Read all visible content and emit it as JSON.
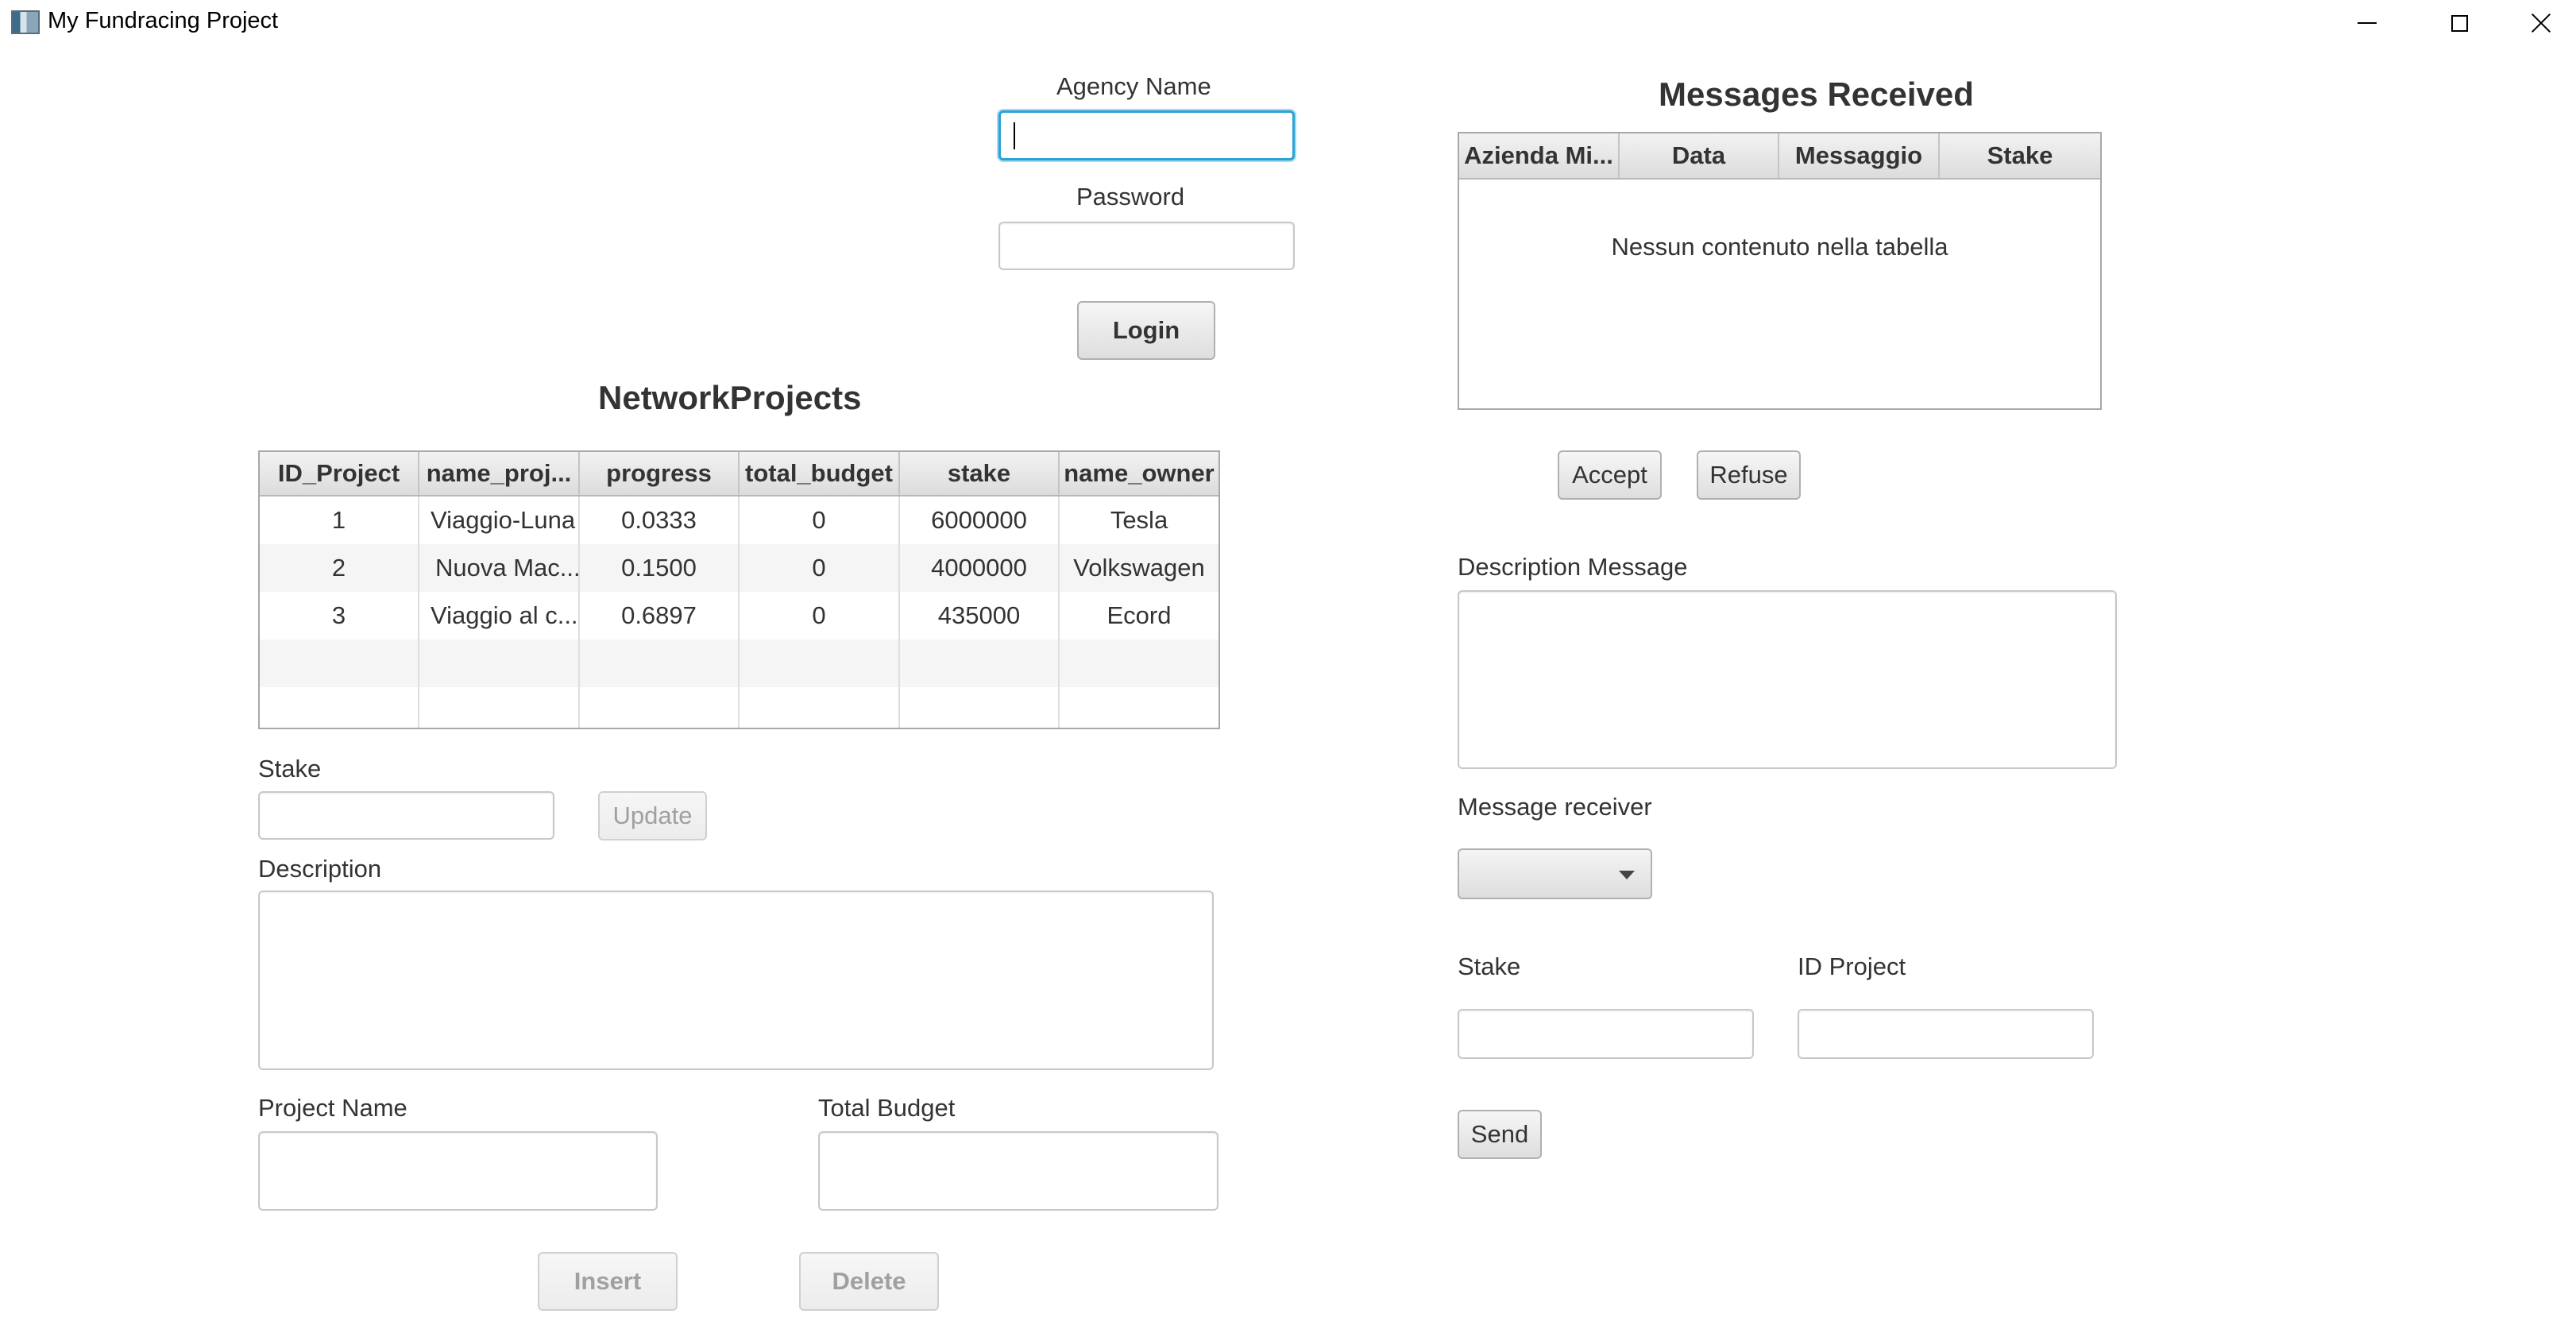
{
  "window": {
    "title": "My Fundracing Project",
    "controls": {
      "minimize": "minimize-icon",
      "maximize": "maximize-icon",
      "close": "close-icon"
    }
  },
  "login": {
    "agency_label": "Agency Name",
    "agency_value": "",
    "password_label": "Password",
    "password_value": "",
    "login_button": "Login"
  },
  "network_projects": {
    "title": "NetworkProjects",
    "columns": [
      "ID_Project",
      "name_proj...",
      "progress",
      "total_budget",
      "stake",
      "name_owner"
    ],
    "rows": [
      [
        "1",
        "Viaggio-Luna",
        "0.0333",
        "0",
        "6000000",
        "Tesla"
      ],
      [
        "2",
        "Nuova Mac...",
        "0.1500",
        "0",
        "4000000",
        "Volkswagen"
      ],
      [
        "3",
        "Viaggio al c...",
        "0.6897",
        "0",
        "435000",
        "Ecord"
      ]
    ]
  },
  "project_form": {
    "stake_label": "Stake",
    "stake_value": "",
    "update_button": "Update",
    "description_label": "Description",
    "description_value": "",
    "project_name_label": "Project Name",
    "project_name_value": "",
    "total_budget_label": "Total Budget",
    "total_budget_value": "",
    "insert_button": "Insert",
    "delete_button": "Delete"
  },
  "messages": {
    "title": "Messages Received",
    "columns": [
      "Azienda Mi...",
      "Data",
      "Messaggio",
      "Stake"
    ],
    "empty_text": "Nessun contenuto nella tabella",
    "accept_button": "Accept",
    "refuse_button": "Refuse"
  },
  "message_form": {
    "description_label": "Description Message",
    "description_value": "",
    "receiver_label": "Message receiver",
    "receiver_selected": "",
    "stake_label": "Stake",
    "stake_value": "",
    "id_project_label": "ID Project",
    "id_project_value": "",
    "send_button": "Send"
  },
  "colors": {
    "focus_ring": "#2ba2d8",
    "text": "#333333",
    "disabled_text": "#a0a0a0",
    "header_bg": "#dcdcdc"
  }
}
